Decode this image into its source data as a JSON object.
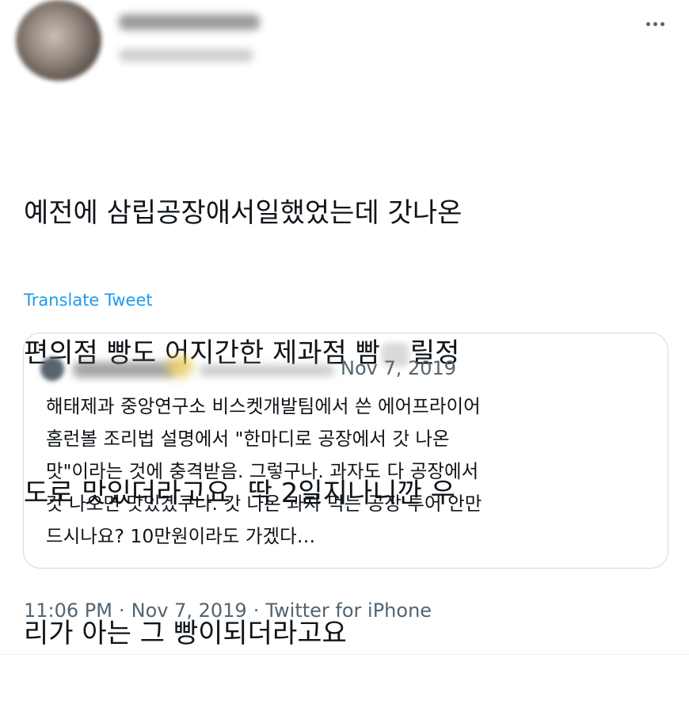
{
  "header": {
    "more_icon": "more-horizontal-icon"
  },
  "tweet": {
    "lines": [
      "예전에 삼립공장애서일했었는데 갓나온",
      "편의점 빵도 어지간한 제과점 빰",
      "도로 맛있더라고요  딱 2일지나니깐 우",
      "리가 아는 그 빵이되더라고요"
    ],
    "line2_tail": "릴정",
    "translate_label": "Translate Tweet"
  },
  "quoted": {
    "date": "Nov 7, 2019",
    "lines": [
      "해태제과 중앙연구소 비스켓개발팀에서 쓴 에어프라이어",
      "홈런볼 조리법 설명에서 \"한마디로 공장에서 갓 나온",
      "맛\"이라는 것에 충격받음. 그렇구나. 과자도 다 공장에서",
      "갓 나오면 맛있겠구나. 갓 나온 과자 먹는 공장 투어 안만",
      "드시나요? 10만원이라도 가겠다…"
    ]
  },
  "meta": {
    "time": "11:06 PM",
    "date": "Nov 7, 2019",
    "source": "Twitter for iPhone",
    "separator": "·"
  },
  "colors": {
    "text": "#0f1419",
    "secondary": "#536471",
    "link": "#1d9bf0",
    "border": "#cfd9de"
  }
}
